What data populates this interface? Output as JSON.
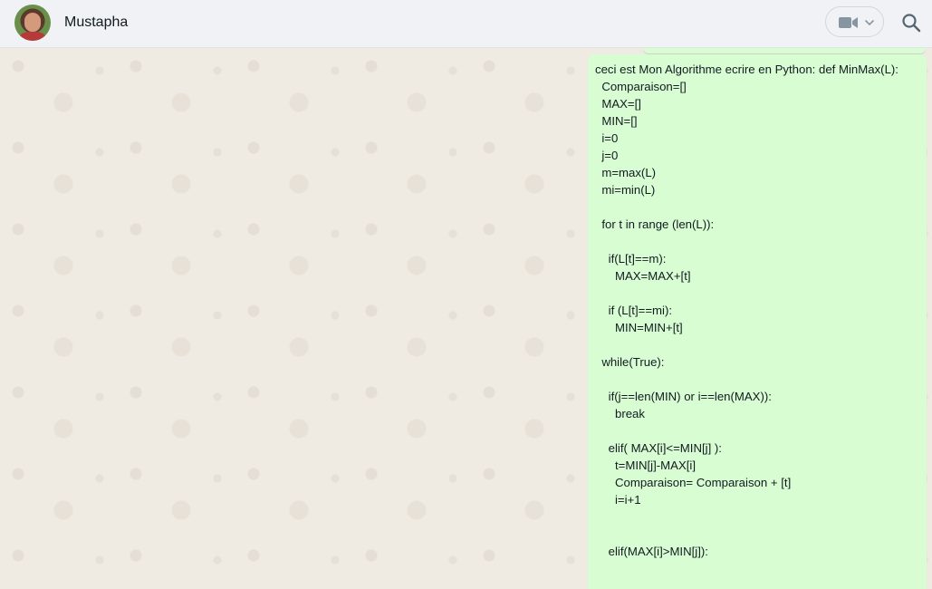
{
  "header": {
    "contact_name": "Mustapha",
    "icons": {
      "video": "video-camera-icon",
      "dropdown": "chevron-down-icon",
      "search": "search-icon"
    }
  },
  "message": {
    "text": "ceci est Mon Algorithme ecrire en Python: def MinMax(L):\n  Comparaison=[]\n  MAX=[]\n  MIN=[]\n  i=0\n  j=0\n  m=max(L)\n  mi=min(L)\n\n  for t in range (len(L)):\n\n    if(L[t]==m):\n      MAX=MAX+[t]\n\n    if (L[t]==mi):\n      MIN=MIN+[t]\n\n  while(True):\n\n    if(j==len(MIN) or i==len(MAX)):\n      break\n\n    elif( MAX[i]<=MIN[j] ):\n      t=MIN[j]-MAX[i]\n      Comparaison= Comparaison + [t]\n      i=i+1\n\n\n    elif(MAX[i]>MIN[j]):"
  },
  "colors": {
    "header_bg": "#f0f2f5",
    "chat_bg": "#efeae2",
    "outgoing_bubble": "#d9fdd3",
    "icon_gray": "#54656f"
  }
}
